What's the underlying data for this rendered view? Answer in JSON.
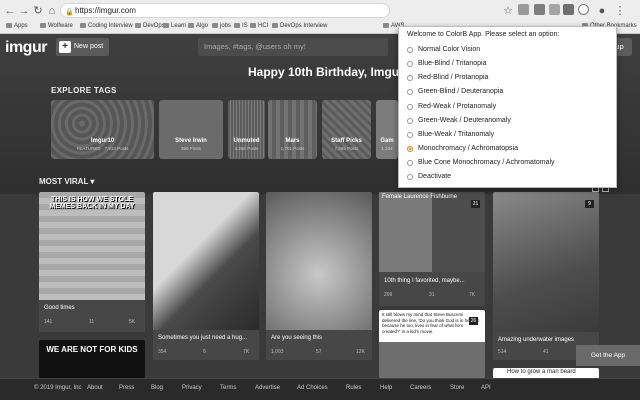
{
  "browser": {
    "url": "https://imgur.com",
    "bookmarks": [
      "Apps",
      "Wolfware",
      "Coding Interview",
      "DevOps",
      "Learn",
      "Algo",
      "jobs",
      "IS",
      "HCI",
      "DevOps Interview",
      "AWS",
      "Other Bookmarks"
    ]
  },
  "site": {
    "logo": "imgur",
    "new_post": "New post",
    "search_placeholder": "Images, #tags, @users oh my!",
    "signup": "Sign up",
    "banner": "Happy 10th Birthday, Imgur!",
    "explore_title": "EXPLORE TAGS",
    "tags": [
      {
        "name": "Imgur10",
        "sub": "FEATURED · 7,913 Posts"
      },
      {
        "name": "Steve Irwin",
        "sub": "359 Posts"
      },
      {
        "name": "Unmuted",
        "sub": "4,268 Posts"
      },
      {
        "name": "Mars",
        "sub": "1,701 Posts"
      },
      {
        "name": "Staff Picks",
        "sub": "7,665 Posts"
      },
      {
        "name": "Gam",
        "sub": "1,234"
      }
    ],
    "sort_label": "MOST VIRAL ▾",
    "posts": [
      {
        "title": "Good times",
        "ups": "141",
        "comments": "11",
        "views": "5K",
        "caption": "THIS IS HOW WE STOLE MEMES BACK IN MY DAY"
      },
      {
        "title": "Sometimes you just need a hug...",
        "ups": "354",
        "comments": "6",
        "views": "7K"
      },
      {
        "title": "Are you seeing this",
        "ups": "1,003",
        "comments": "57",
        "views": "12K"
      },
      {
        "title": "10th thing I favorited, maybe...",
        "ups": "299",
        "comments": "31",
        "views": "7K",
        "caption": "Female Laurence Fishburne",
        "badge": "21"
      },
      {
        "title": "Amazing underwater images",
        "ups": "514",
        "comments": "41",
        "views": "7K",
        "badge": "9"
      },
      {
        "caption": "WE ARE NOT FOR KIDS"
      },
      {
        "caption": "It still blows my mind that Steve Buscemi delivered the line, 'Do you think God is in heaven because he too, lives in fear of what he's created?' in a kid's movie.",
        "badge": "26"
      },
      {
        "title": "How to grow a man beard"
      }
    ],
    "footer_links": [
      "© 2019 Imgur, Inc",
      "About",
      "Press",
      "Blog",
      "Privacy",
      "Terms",
      "Advertise",
      "Ad Choices",
      "Rules",
      "Help",
      "Careers",
      "Store",
      "API"
    ],
    "get_app": "Get the App"
  },
  "popup": {
    "title": "Welcome to ColorB App. Please select an option:",
    "options": [
      "Normal Color Vision",
      "Blue-Blind / Tritanopia",
      "Red-Blind / Protanopia",
      "Green-Blind / Deuteranopia",
      "Red-Weak / Protanomaly",
      "Green-Weak / Deuteranomaly",
      "Blue-Weak / Tritanomaly",
      "Monochromacy / Achromatopsia",
      "Blue Cone Monochromacy / Achromatomaly",
      "Deactivate"
    ],
    "selected": "Monochromacy / Achromatopsia"
  }
}
